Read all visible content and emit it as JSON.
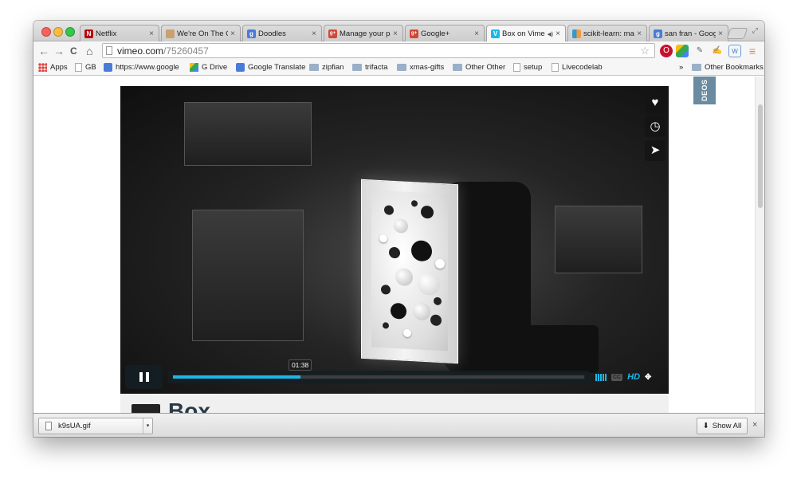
{
  "tabs": [
    {
      "label": "Netflix",
      "icon": "netflix-icon",
      "color": "#b9090b",
      "glyph": "N",
      "close": "×"
    },
    {
      "label": "We're On The Go",
      "icon": "bookmark-icon",
      "color": "#c9a070",
      "glyph": "",
      "close": "×"
    },
    {
      "label": "Doodles",
      "icon": "google-icon",
      "color": "#4a7bd8",
      "glyph": "g",
      "close": "×"
    },
    {
      "label": "Manage your pa",
      "icon": "google-plus-icon",
      "color": "#d14836",
      "glyph": "g+",
      "close": "×"
    },
    {
      "label": "Google+",
      "icon": "google-plus-icon",
      "color": "#d14836",
      "glyph": "g+",
      "close": "×"
    },
    {
      "label": "Box on Vimeo",
      "icon": "vimeo-icon",
      "color": "#1ab7ea",
      "glyph": "V",
      "close": "×",
      "sound": "◀)"
    },
    {
      "label": "scikit-learn: mac",
      "icon": "chart-icon",
      "color": "#f89939",
      "glyph": "",
      "close": "×"
    },
    {
      "label": "san fran - Goog",
      "icon": "google-icon",
      "color": "#4a7bd8",
      "glyph": "g",
      "close": "×"
    }
  ],
  "toolbar": {
    "url_host": "vimeo.com",
    "url_path": "/75260457",
    "back": "←",
    "forward": "→",
    "reload": "C",
    "home": "⌂",
    "star": "☆"
  },
  "bookmarks": [
    {
      "label": "Apps",
      "type": "apps"
    },
    {
      "label": "GB",
      "type": "page"
    },
    {
      "label": "https://www.google",
      "type": "google"
    },
    {
      "label": "G Drive",
      "type": "drive"
    },
    {
      "label": "Google Translate",
      "type": "translate"
    },
    {
      "label": "zipfian",
      "type": "folder"
    },
    {
      "label": "trifacta",
      "type": "folder"
    },
    {
      "label": "xmas-gifts",
      "type": "folder"
    },
    {
      "label": "Other Other",
      "type": "folder"
    },
    {
      "label": "setup",
      "type": "page"
    },
    {
      "label": "Livecodelab",
      "type": "page"
    }
  ],
  "bookmarks_overflow": "»",
  "other_bookmarks": "Other Bookmarks",
  "video": {
    "time_tooltip": "01:38",
    "progress": 0.31,
    "hd_label": "HD",
    "cc_label": "CC",
    "title": "Box",
    "side_buttons": [
      "like-icon",
      "watch-later-icon",
      "share-icon"
    ]
  },
  "side_tab": "DEOS",
  "download": {
    "file": "k9sUA.gif",
    "show_all": "Show All",
    "close": "×"
  },
  "colors": {
    "accent": "#1ab7ea",
    "title": "#2a3a49"
  }
}
